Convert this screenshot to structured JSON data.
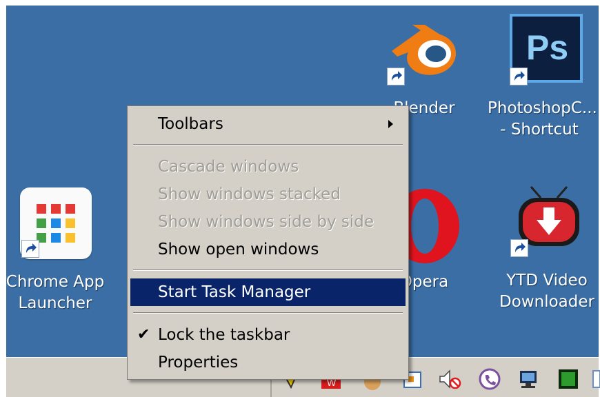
{
  "desktop": {
    "icons": [
      {
        "label": "Chrome App Launcher",
        "line1": "Chrome App",
        "line2": "Launcher"
      },
      {
        "label": "Blender",
        "line1": "Blender",
        "line2": ""
      },
      {
        "label": "PhotoshopC... - Shortcut",
        "line1": "PhotoshopC...",
        "line2": "- Shortcut"
      },
      {
        "label": "Opera",
        "line1": "Opera",
        "line2": ""
      },
      {
        "label": "YTD Video Downloader",
        "line1": "YTD Video",
        "line2": "Downloader"
      }
    ]
  },
  "context_menu": {
    "toolbars": "Toolbars",
    "cascade": "Cascade windows",
    "stacked": "Show windows stacked",
    "side_by_side": "Show windows side by side",
    "show_open": "Show open windows",
    "task_manager": "Start Task Manager",
    "lock_taskbar": "Lock the taskbar",
    "lock_checked_mark": "✔",
    "properties": "Properties"
  },
  "tray": {
    "icons": [
      "flag-icon",
      "app-icon",
      "volume-muted-icon",
      "viber-icon",
      "network-icon",
      "monitor-icon",
      "display-icon"
    ]
  },
  "colors": {
    "desktop": "#3a6ea5",
    "menu": "#d4d0c8",
    "highlight": "#0a246a"
  }
}
